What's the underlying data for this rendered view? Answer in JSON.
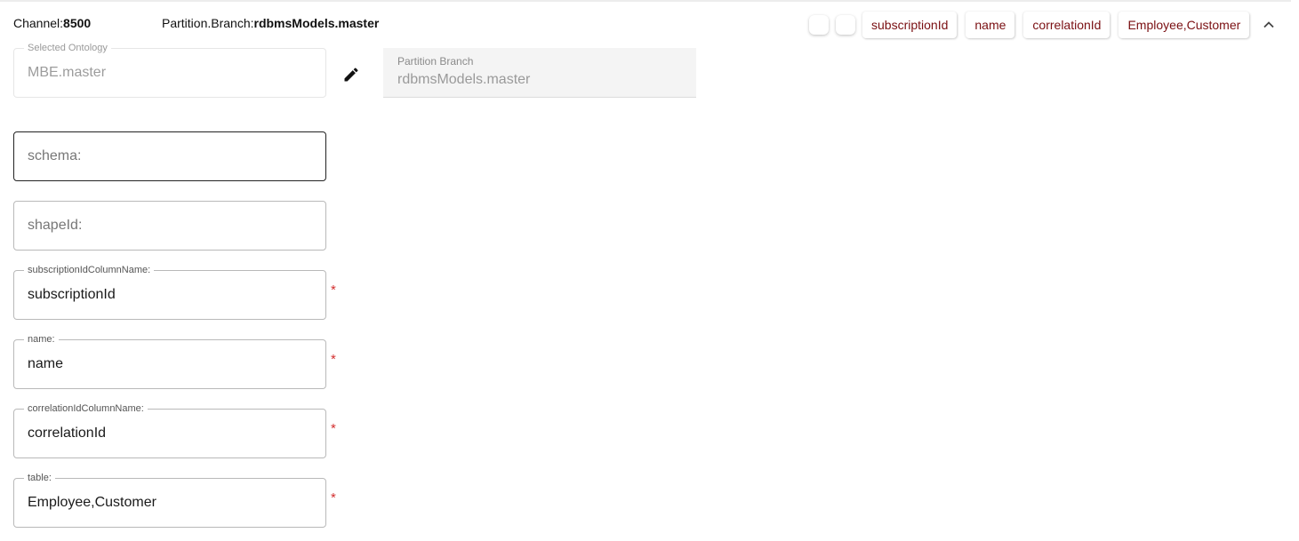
{
  "header": {
    "channel_label": "Channel:",
    "channel_value": "8500",
    "branch_label": "Partition.Branch:",
    "branch_value": "rdbmsModels.master"
  },
  "chips": [
    "subscriptionId",
    "name",
    "correlationId",
    "Employee,Customer"
  ],
  "ontology": {
    "label": "Selected Ontology",
    "value": "MBE.master"
  },
  "partition": {
    "label": "Partition Branch",
    "value": "rdbmsModels.master"
  },
  "fields": {
    "schema": {
      "placeholder": "schema:"
    },
    "shapeId": {
      "placeholder": "shapeId:"
    },
    "subscriptionIdColumnName": {
      "label": "subscriptionIdColumnName:",
      "value": "subscriptionId",
      "required": "*"
    },
    "name": {
      "label": "name:",
      "value": "name",
      "required": "*"
    },
    "correlationIdColumnName": {
      "label": "correlationIdColumnName:",
      "value": "correlationId",
      "required": "*"
    },
    "table": {
      "label": "table:",
      "value": "Employee,Customer",
      "required": "*"
    }
  },
  "colors": {
    "chip_text": "#7a0f12",
    "required": "#d32f2f"
  },
  "icons": {
    "edit": "pencil-icon",
    "collapse": "chevron-up-icon"
  }
}
